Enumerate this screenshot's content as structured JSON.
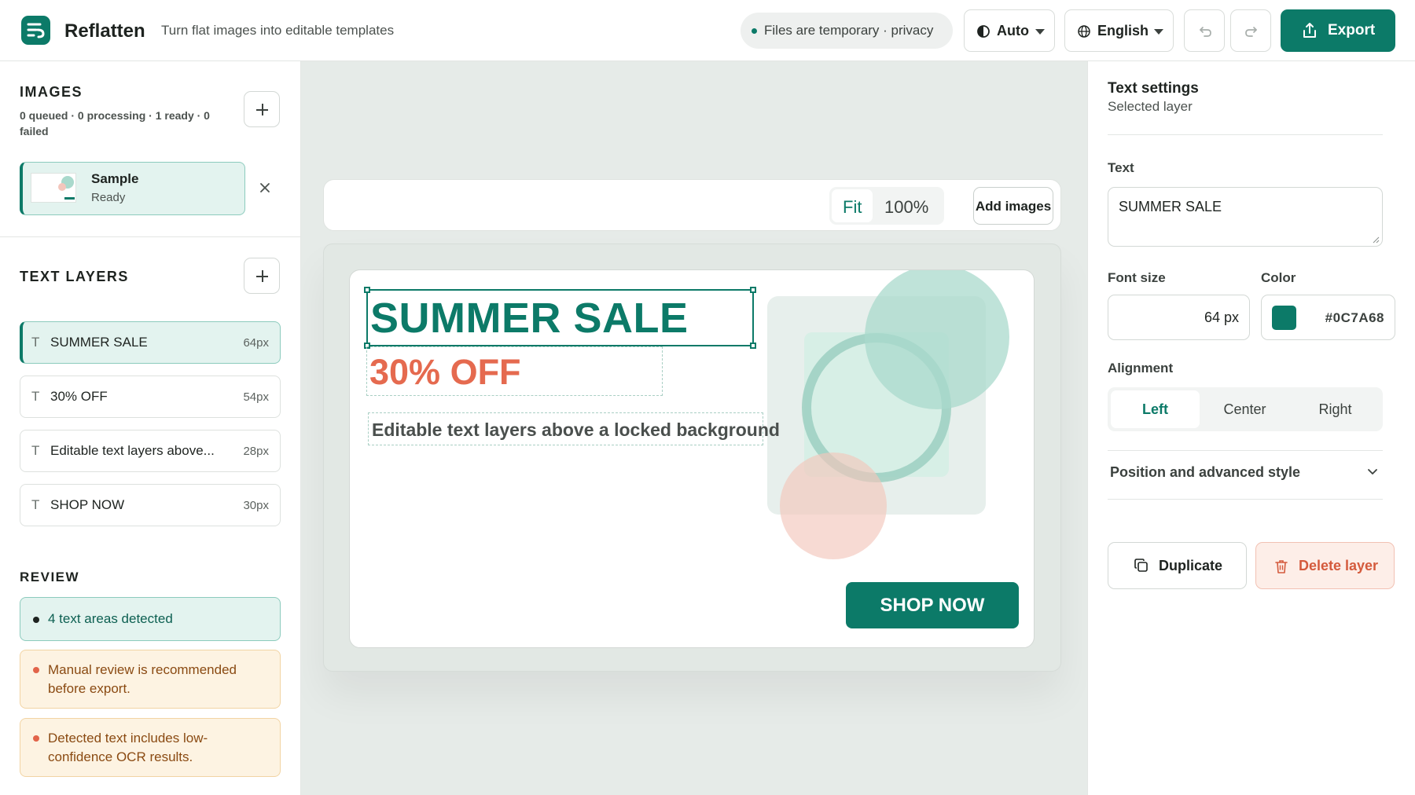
{
  "app": {
    "name": "Reflatten",
    "tagline": "Turn flat images into editable templates"
  },
  "header": {
    "privacy": "Files are temporary · privacy",
    "theme": "Auto",
    "language": "English",
    "export_label": "Export"
  },
  "images": {
    "title": "IMAGES",
    "summary": "0 queued · 0 processing · 1 ready · 0 failed",
    "items": [
      {
        "name": "Sample",
        "status": "Ready"
      }
    ]
  },
  "text_layers": {
    "title": "TEXT LAYERS",
    "items": [
      {
        "name": "SUMMER SALE",
        "size": "64px"
      },
      {
        "name": "30% OFF",
        "size": "54px"
      },
      {
        "name": "Editable text layers above...",
        "size": "28px"
      },
      {
        "name": "SHOP NOW",
        "size": "30px"
      }
    ]
  },
  "review": {
    "title": "REVIEW",
    "items": [
      {
        "text": "4 text areas detected",
        "level": "ok"
      },
      {
        "text": "Manual review is recommended before export.",
        "level": "warn"
      },
      {
        "text": "Detected text includes low-confidence OCR results.",
        "level": "warn"
      }
    ]
  },
  "canvas": {
    "fit_label": "Fit",
    "zoom": "100%",
    "add_images_label": "Add images",
    "artboard": {
      "headline": "SUMMER SALE",
      "discount": "30% OFF",
      "caption": "Editable text layers above a locked background",
      "cta": "SHOP NOW"
    }
  },
  "settings": {
    "title": "Text settings",
    "subtitle": "Selected layer",
    "text_label": "Text",
    "text_value": "SUMMER SALE",
    "font_size_label": "Font size",
    "font_size_value": "64 px",
    "color_label": "Color",
    "color_value": "#0C7A68",
    "alignment_label": "Alignment",
    "alignment_options": [
      "Left",
      "Center",
      "Right"
    ],
    "alignment_selected": "Left",
    "advanced_label": "Position and advanced style",
    "duplicate_label": "Duplicate",
    "delete_label": "Delete layer"
  },
  "colors": {
    "accent": "#0C7A68",
    "discount": "#E56A4F",
    "warning_bg": "#FDF3E2",
    "danger": "#D45A3C"
  }
}
